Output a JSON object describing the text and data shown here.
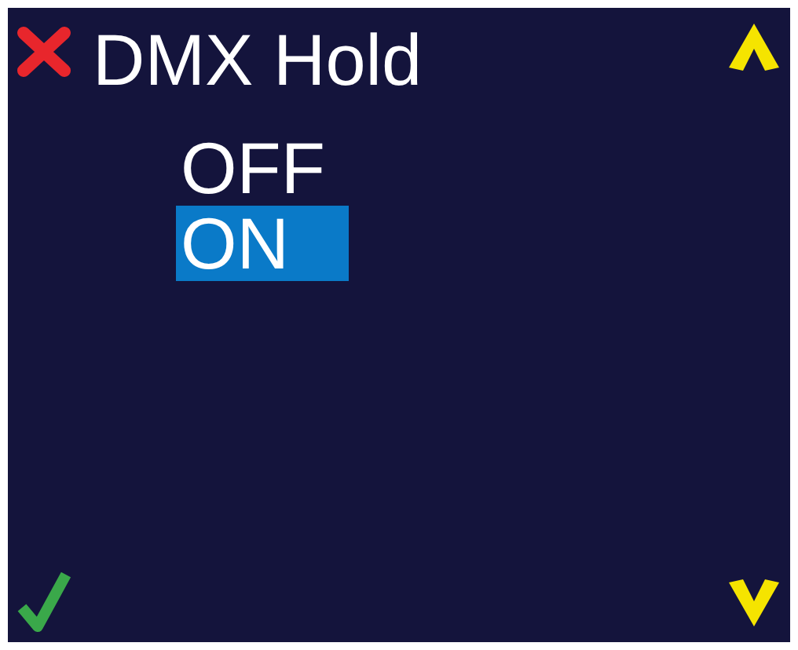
{
  "title": "DMX Hold",
  "options": [
    {
      "label": "OFF",
      "selected": false
    },
    {
      "label": "ON",
      "selected": true
    }
  ]
}
